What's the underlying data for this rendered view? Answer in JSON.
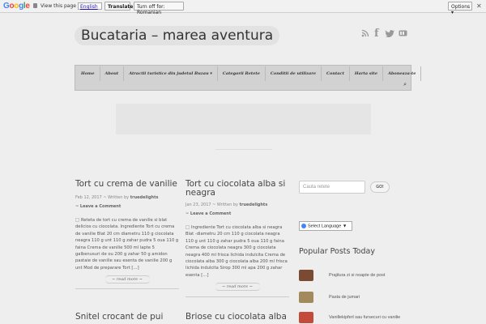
{
  "translate_bar": {
    "logo": [
      "G",
      "o",
      "o",
      "g",
      "l",
      "e"
    ],
    "prompt": "View this page in:",
    "language": "English",
    "translate_label": "Translate",
    "turnoff_label": "Turn off for: Romanian",
    "options_label": "Options ▾",
    "close": "✕"
  },
  "site": {
    "title": "Bucataria – marea aventura"
  },
  "social_icons": [
    "rss-icon",
    "facebook-icon",
    "twitter-icon",
    "youtube-icon"
  ],
  "nav": {
    "items": [
      "Home",
      "About",
      "Atractii turistice din judetul Buzau ▾",
      "Categorii Retete",
      "Conditii de utilizare",
      "Contact",
      "Harta site",
      "Aboneaza-te"
    ],
    "search_icon": "⌕"
  },
  "posts": [
    {
      "title": "Tort cu crema de vanilie",
      "date": "Feb 12, 2017",
      "author_prefix": "~ Written by",
      "author": "truedelights",
      "comment": "~ Leave a Comment",
      "excerpt": "Reteta de tort cu crema de vanilie si blat delicios cu ciocolata. Ingrediente Tort cu crema de vanilie Blat 20 cm diametru 110 g ciocolata neagra 110 g unt 110 g zahar pudra 5 oua 110 g faina Crema de vanilie 500 ml lapte 5 galbenusuri de ou 200 g zahar 50 g amidon pastaie de vanilie sau esenta de vanilie 200 g unt Mod de preparare Tort […]",
      "read_more": "~ read more ~"
    },
    {
      "title": "Tort cu ciocolata alba si neagra",
      "date": "Jan 23, 2017",
      "author_prefix": "~ Written by",
      "author": "truedelights",
      "comment": "~ Leave a Comment",
      "excerpt": "Ingrediente Tort cu ciocolata alba si neagra Blat -diametru 20 cm 110 g ciocolata neagra 110 g unt 110 g zahar pudra 5 oua 110 g faina Crema de ciocolata neagra 300 g ciocolata neagra 400 ml frisca lichida indulcita Crema de ciocolata alba 300 g ciocolata alba 200 ml frisca lichida indulcita Sirop 300 ml apa 200 g zahar esenta […]",
      "read_more": "~ read more ~"
    },
    {
      "title": "Snitel crocant de pui"
    },
    {
      "title": "Briose cu ciocolata alba"
    }
  ],
  "sidebar": {
    "search_placeholder": "Cauta retete",
    "search_button": "GO!",
    "language_select": "Select Language ▼",
    "popular_title": "Popular Posts Today",
    "popular": [
      {
        "label": "Prajitura zi si noapte de post",
        "color": "#7a4a33"
      },
      {
        "label": "Pasta de jumari",
        "color": "#a38a5c"
      },
      {
        "label": "Vanillekipferl sau fursecuri cu vanilie",
        "color": "#c44a3a"
      }
    ]
  }
}
